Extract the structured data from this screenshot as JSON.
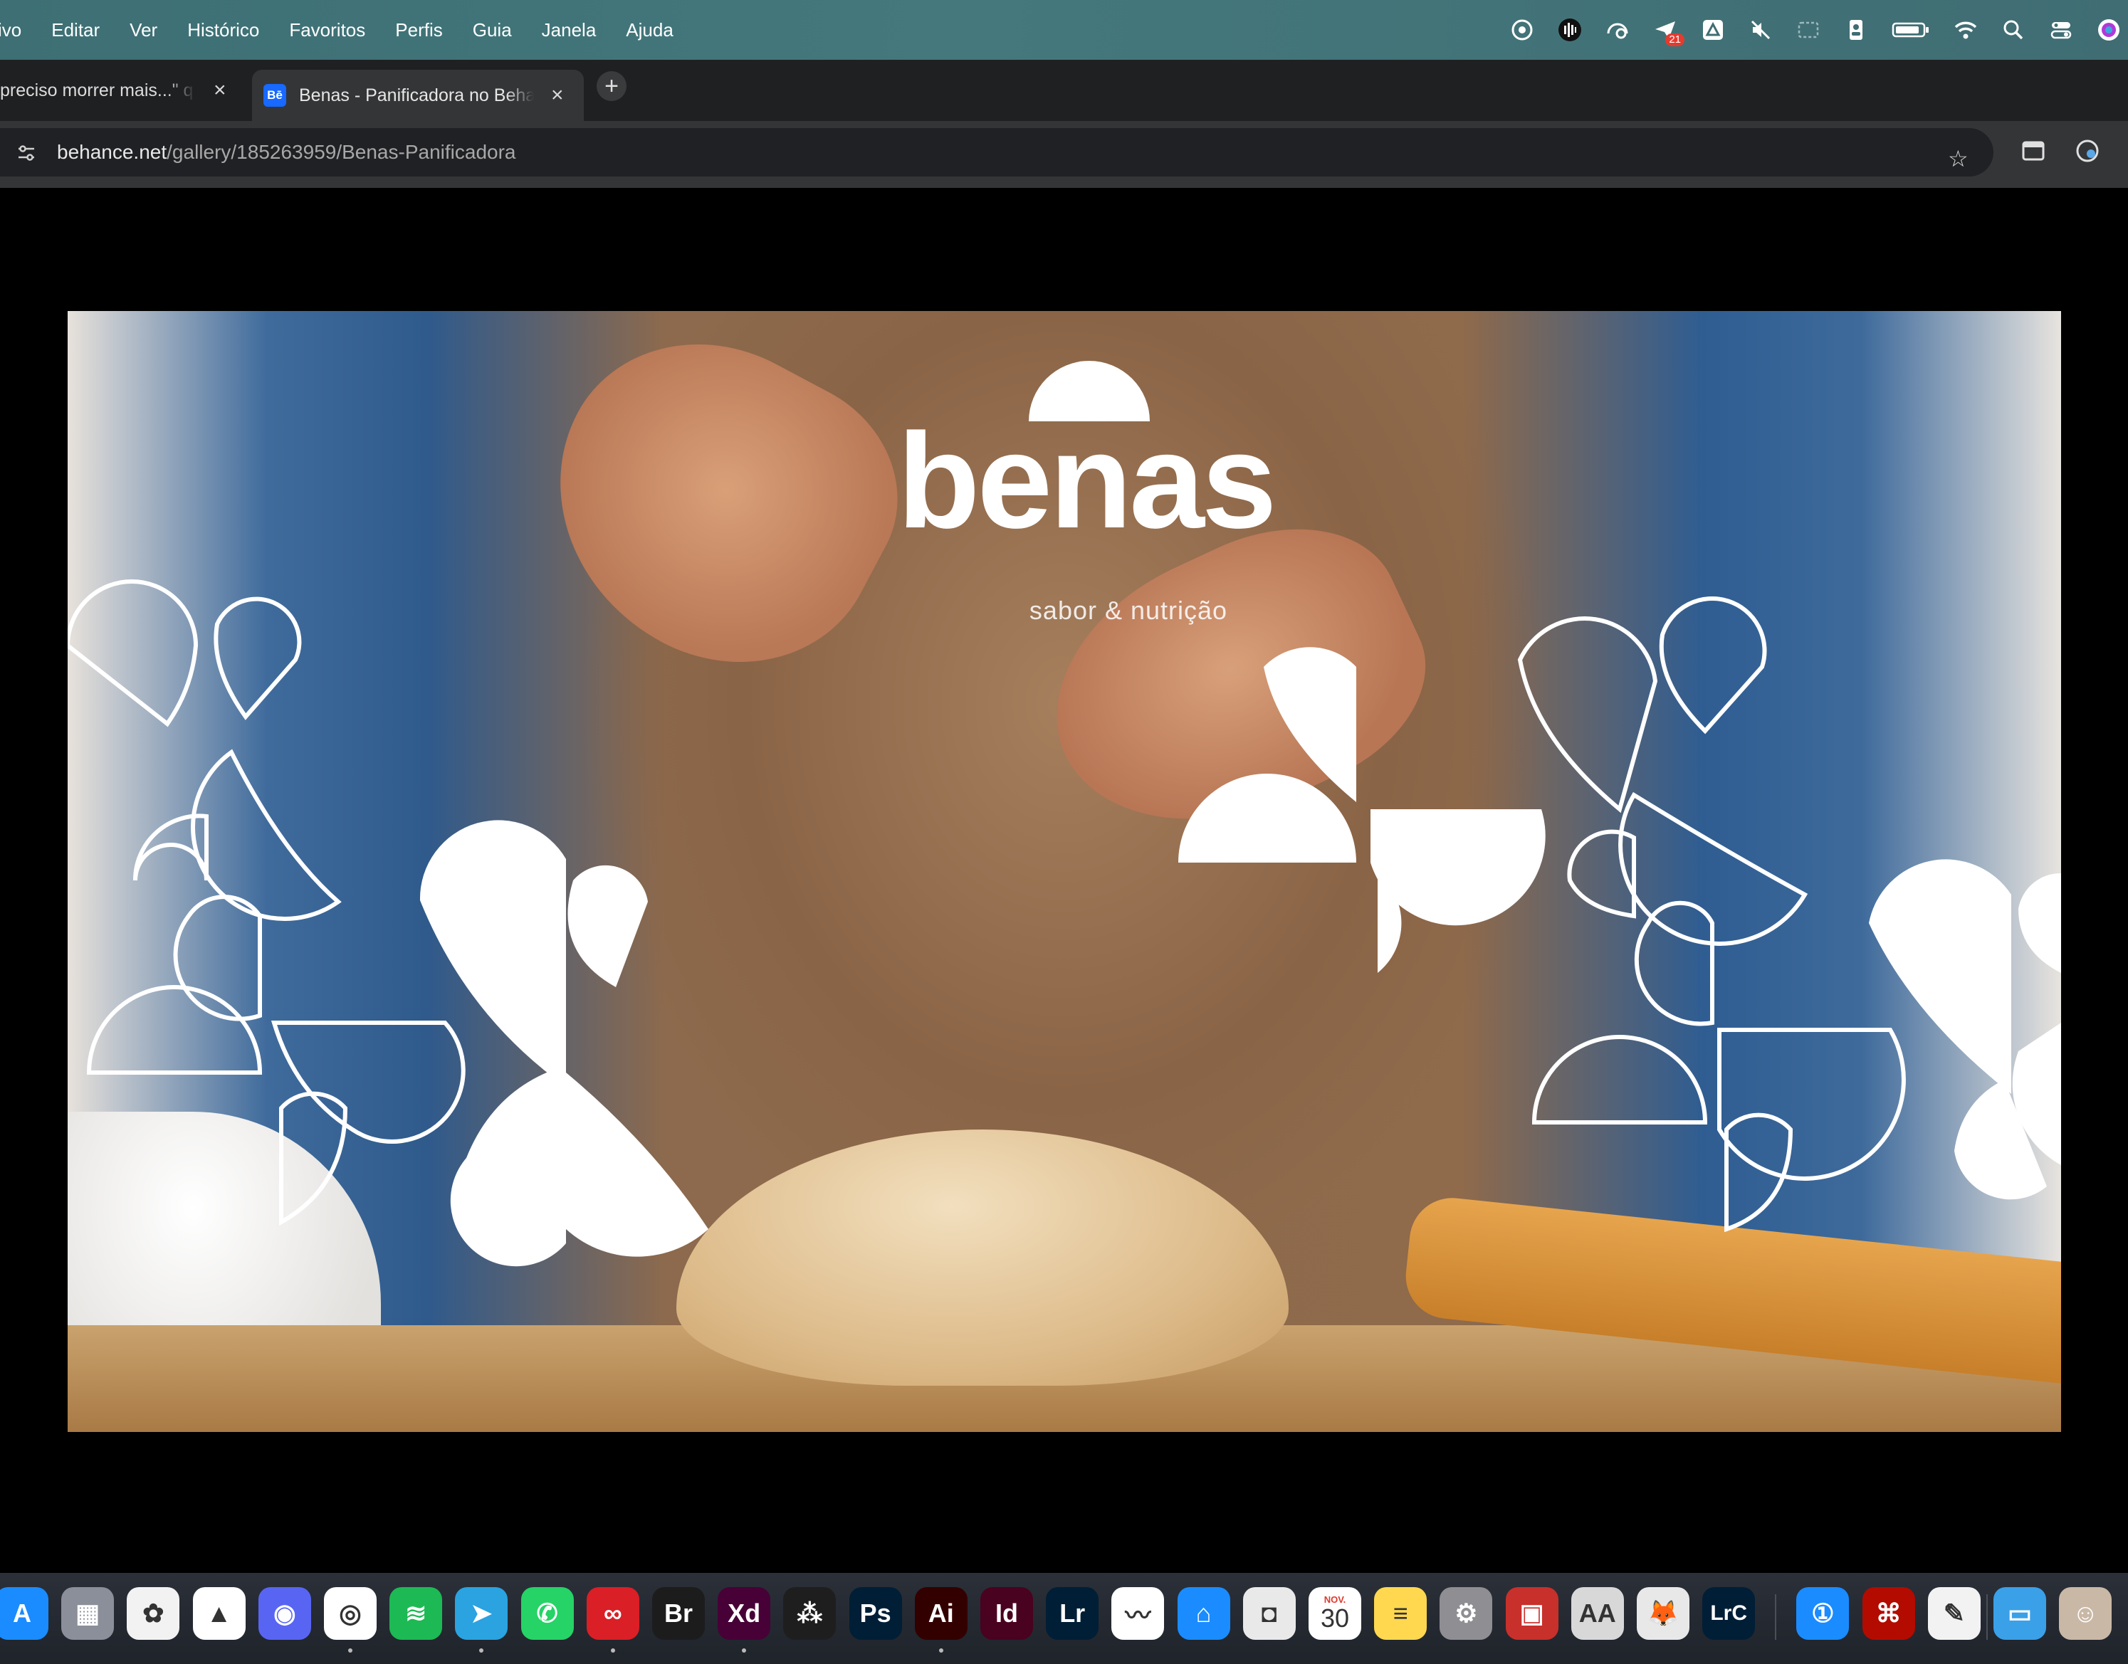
{
  "menubar": {
    "items": [
      "ivo",
      "Editar",
      "Ver",
      "Histórico",
      "Favoritos",
      "Perfis",
      "Guia",
      "Janela",
      "Ajuda"
    ],
    "status_icons": [
      "privacy-icon",
      "audio-waves-icon",
      "network-monitor-icon",
      "airmail-icon",
      "drive-icon",
      "mute-icon",
      "window-icon",
      "contact-icon",
      "battery-icon",
      "wifi-icon",
      "spotlight-icon",
      "control-center-icon",
      "siri-icon"
    ],
    "airmail_badge": "21"
  },
  "tabs": [
    {
      "title": "preciso morrer mais...\" q",
      "active": false
    },
    {
      "title": "Benas - Panificadora no Behance",
      "active": true,
      "favicon": "Bē"
    }
  ],
  "address": {
    "host": "behance.net",
    "path": "/gallery/185263959/Benas-Panificadora"
  },
  "hero": {
    "brand_name": "benas",
    "tagline": "sabor & nutrição"
  },
  "dock": {
    "apps": [
      {
        "name": "App Store",
        "label": "A",
        "color": "#1a8cff"
      },
      {
        "name": "Launchpad",
        "label": "▦",
        "color": "#8a8f99"
      },
      {
        "name": "Photos",
        "label": "✿",
        "color": "#f2f2f2"
      },
      {
        "name": "Google Drive",
        "label": "▲",
        "color": "#ffffff"
      },
      {
        "name": "Discord",
        "label": "◉",
        "color": "#5865f2"
      },
      {
        "name": "Chrome",
        "label": "◎",
        "color": "#ffffff"
      },
      {
        "name": "Spotify",
        "label": "≋",
        "color": "#1db954"
      },
      {
        "name": "Telegram",
        "label": "➤",
        "color": "#2aa3e0"
      },
      {
        "name": "WhatsApp",
        "label": "✆",
        "color": "#25d366"
      },
      {
        "name": "Creative Cloud",
        "label": "∞",
        "color": "#da1f26"
      },
      {
        "name": "Bridge",
        "label": "Br",
        "color": "#1c1c1c"
      },
      {
        "name": "Adobe XD",
        "label": "Xd",
        "color": "#470137"
      },
      {
        "name": "Figma",
        "label": "⁂",
        "color": "#1e1e1e"
      },
      {
        "name": "Photoshop",
        "label": "Ps",
        "color": "#001e36"
      },
      {
        "name": "Illustrator",
        "label": "Ai",
        "color": "#330000"
      },
      {
        "name": "InDesign",
        "label": "Id",
        "color": "#49021f"
      },
      {
        "name": "Lightroom",
        "label": "Lr",
        "color": "#001e36"
      },
      {
        "name": "Freeform",
        "label": "〰",
        "color": "#ffffff"
      },
      {
        "name": "Keynote",
        "label": "⌂",
        "color": "#1a8cff"
      },
      {
        "name": "Screenshot",
        "label": "◘",
        "color": "#e9e9e9"
      },
      {
        "name": "Calendar",
        "label": "30",
        "color": "#ffffff",
        "month": "NOV."
      },
      {
        "name": "Notes",
        "label": "≡",
        "color": "#ffd84f"
      },
      {
        "name": "System Settings",
        "label": "⚙",
        "color": "#8e8e93"
      },
      {
        "name": "Photo Booth",
        "label": "▣",
        "color": "#c8302b"
      },
      {
        "name": "Font Book",
        "label": "AA",
        "color": "#d8d8d8"
      },
      {
        "name": "Firefox Dev",
        "label": "🦊",
        "color": "#e8e8e8"
      },
      {
        "name": "Lightroom Classic",
        "label": "LrC",
        "color": "#001e36"
      },
      {
        "name": "1Password",
        "label": "①",
        "color": "#1a8cff"
      },
      {
        "name": "Acrobat",
        "label": "⌘",
        "color": "#b30b00"
      },
      {
        "name": "TextEdit",
        "label": "✎",
        "color": "#f2f2f2"
      },
      {
        "name": "Downloads",
        "label": "▭",
        "color": "#3aa0e8"
      },
      {
        "name": "Contact",
        "label": "☺",
        "color": "#c9b8a6"
      }
    ]
  }
}
